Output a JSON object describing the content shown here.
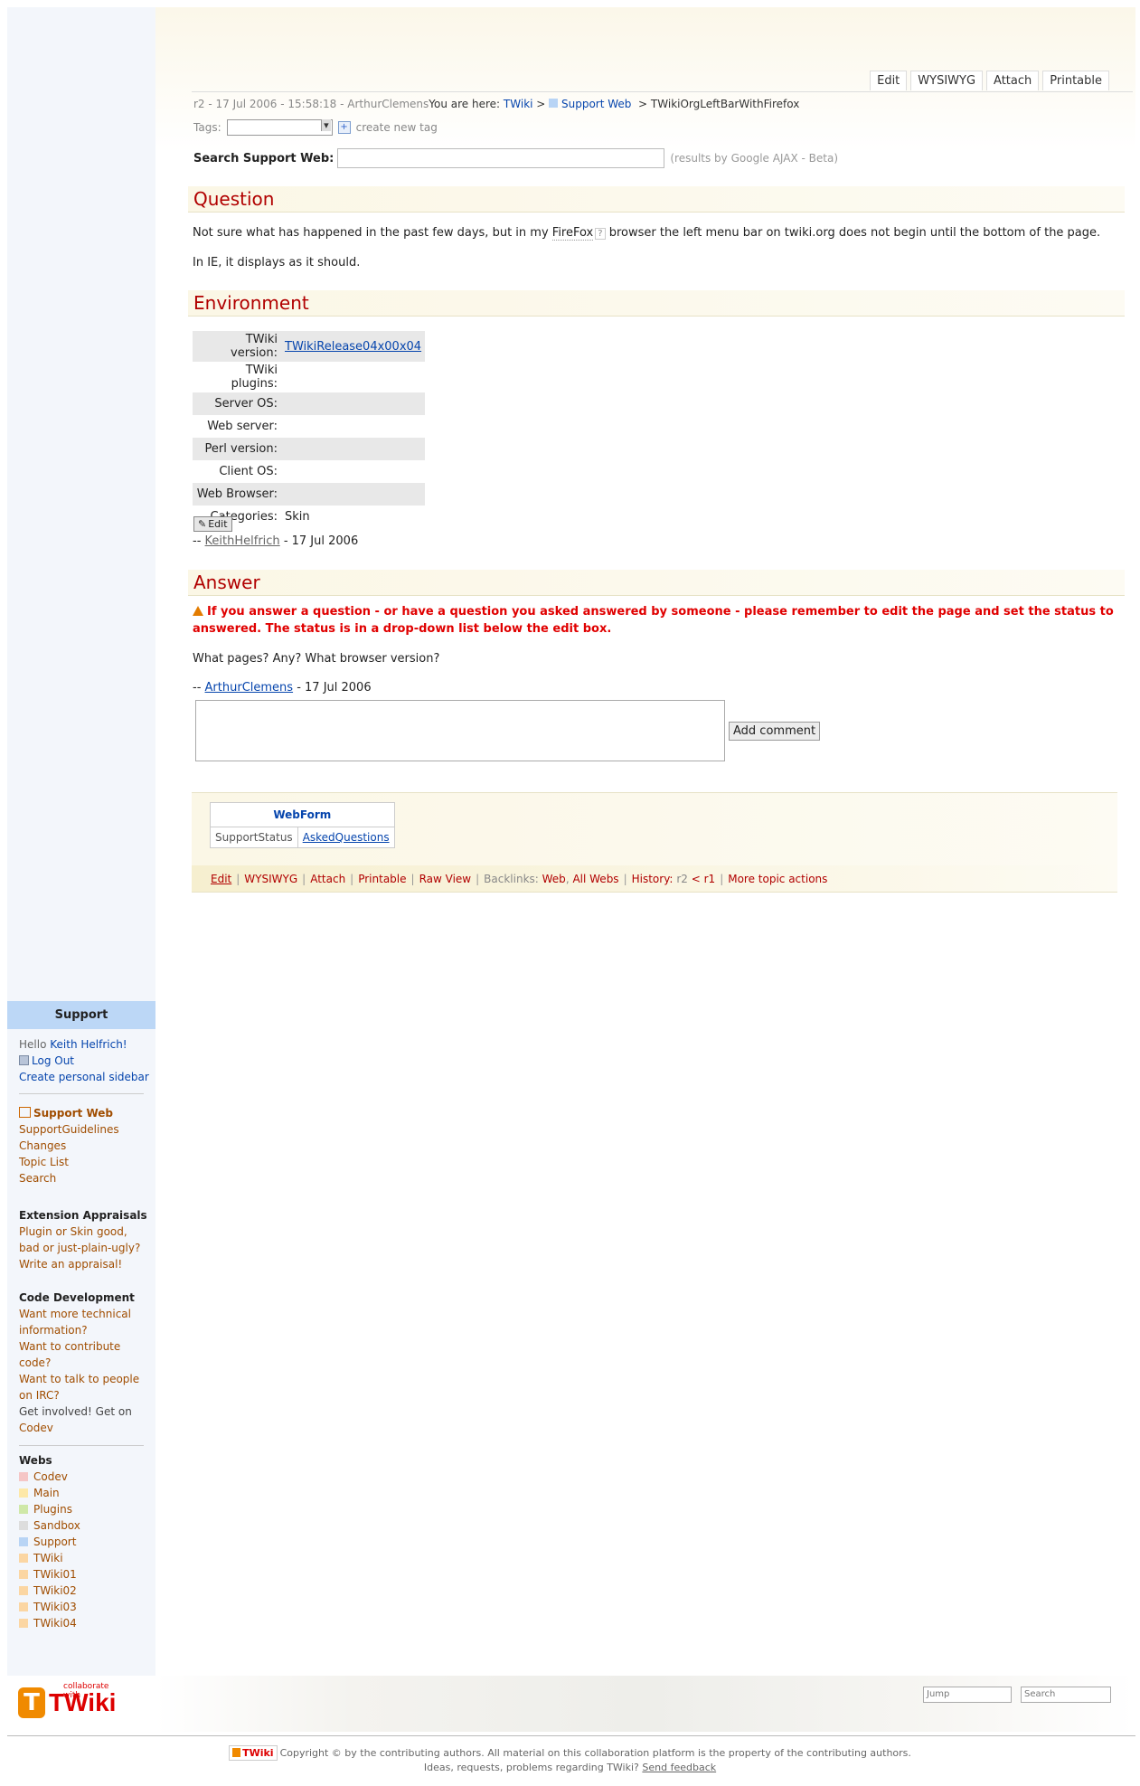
{
  "topbar": {
    "actions": [
      "Edit",
      "WYSIWYG",
      "Attach",
      "Printable"
    ],
    "revision": "r2 - 17 Jul 2006 - 15:58:18 - ArthurClemens",
    "you_are_here": "You are here:",
    "crumbs": [
      "TWiki",
      "Support Web"
    ],
    "current_topic": "TWikiOrgLeftBarWithFirefox",
    "tags_label": "Tags:",
    "create_tag": "create new tag",
    "search_label": "Search Support Web:",
    "search_hint": "(results by Google AJAX - Beta)"
  },
  "question": {
    "heading": "Question",
    "line1_before": "Not sure what has happened in the past few days, but in my",
    "line1_link": "FireFox",
    "line1_q": "?",
    "line1_after": "browser the left menu bar on twiki.org does not begin until the bottom of the page.",
    "line2": "In IE, it displays as it should."
  },
  "environment": {
    "heading": "Environment",
    "rows": [
      {
        "key": "TWiki version:",
        "value": "TWikiRelease04x00x04"
      },
      {
        "key": "TWiki plugins:",
        "value": ""
      },
      {
        "key": "Server OS:",
        "value": ""
      },
      {
        "key": "Web server:",
        "value": ""
      },
      {
        "key": "Perl version:",
        "value": ""
      },
      {
        "key": "Client OS:",
        "value": ""
      },
      {
        "key": "Web Browser:",
        "value": ""
      },
      {
        "key": "Categories:",
        "value": "Skin"
      }
    ],
    "edit_label": "Edit",
    "sig_prefix": "--",
    "sig_name": "KeithHelfrich",
    "sig_date": "- 17 Jul 2006"
  },
  "answer": {
    "heading": "Answer",
    "warning": "If you answer a question - or have a question you asked answered by someone - please remember to edit the page and set the status to answered. The status is in a drop-down list below the edit box.",
    "text": "What pages? Any? What browser version?",
    "sig_prefix": "--",
    "sig_name": "ArthurClemens",
    "sig_date": "- 17 Jul 2006",
    "comment_button": "Add comment"
  },
  "form": {
    "title": "WebForm",
    "field": "SupportStatus",
    "value": "AskedQuestions"
  },
  "bottom_links": {
    "edit": "Edit",
    "wysiwyg": "WYSIWYG",
    "attach": "Attach",
    "printable": "Printable",
    "raw": "Raw View",
    "backlinks": "Backlinks:",
    "web": "Web",
    "all_webs": "All Webs",
    "history": "History:",
    "r2": "r2",
    "lt": "<",
    "r1": "r1",
    "more": "More topic actions"
  },
  "sidebar": {
    "header": "Support",
    "hello": "Hello",
    "user": "Keith Helfrich!",
    "logout": "Log Out",
    "personal": "Create personal sidebar",
    "web_title": "Support Web",
    "web_links": [
      "SupportGuidelines",
      "Changes",
      "Topic List",
      "Search"
    ],
    "ext_title": "Extension Appraisals",
    "ext_text": [
      "Plugin or Skin good,",
      "bad or just-plain-ugly?",
      "Write an appraisal!"
    ],
    "code_title": "Code Development",
    "code_lines": [
      "Want more technical",
      "information?",
      "Want to contribute",
      "code?",
      "Want to talk to people",
      "on IRC?",
      "Get involved! Get on",
      "Codev"
    ],
    "webs_title": "Webs",
    "webs": [
      {
        "name": "Codev",
        "color": "#f5c6c6"
      },
      {
        "name": "Main",
        "color": "#fde8a8"
      },
      {
        "name": "Plugins",
        "color": "#cfe8a8"
      },
      {
        "name": "Sandbox",
        "color": "#dddddd"
      },
      {
        "name": "Support",
        "color": "#b8d4f5"
      },
      {
        "name": "TWiki",
        "color": "#fbd6a3"
      },
      {
        "name": "TWiki01",
        "color": "#fbd6a3"
      },
      {
        "name": "TWiki02",
        "color": "#fbd6a3"
      },
      {
        "name": "TWiki03",
        "color": "#fbd6a3"
      },
      {
        "name": "TWiki04",
        "color": "#fbd6a3"
      }
    ]
  },
  "footer": {
    "logo_tag": "collaborate with",
    "logo_word": "TWiki",
    "jump": "Jump",
    "search": "Search",
    "copyright": "Copyright © by the contributing authors. All material on this collaboration platform is the property of the contributing authors.",
    "ideas": "Ideas, requests, problems regarding TWiki?",
    "feedback": "Send feedback"
  }
}
